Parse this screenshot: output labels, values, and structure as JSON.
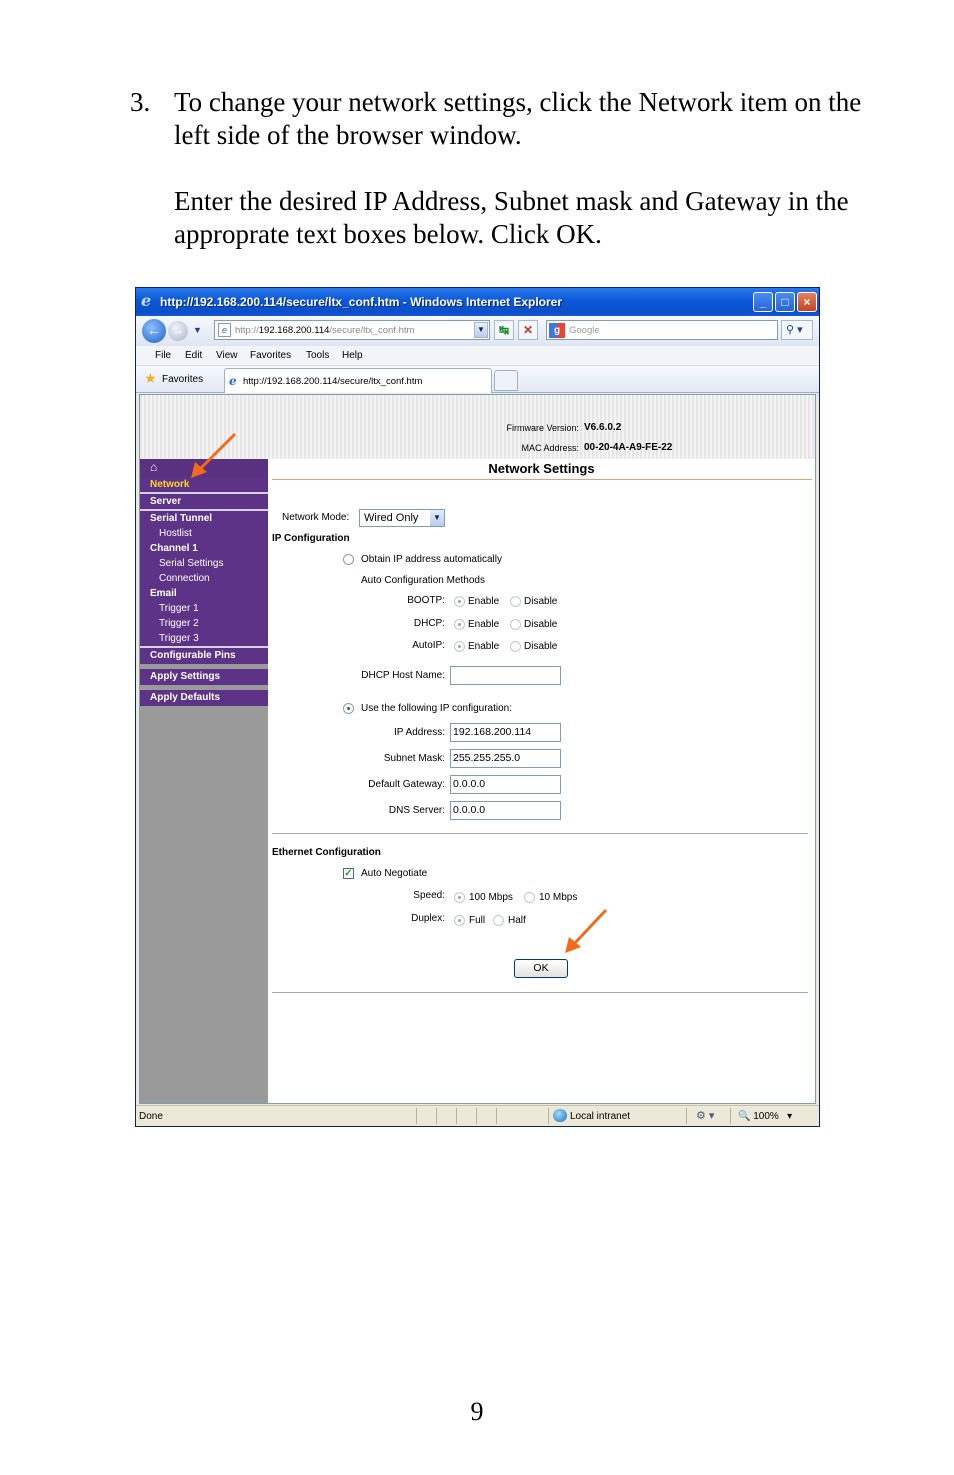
{
  "doc": {
    "step_number": "3.",
    "paragraph1": "To change your network settings, click the Network item on the left side of the browser window.",
    "paragraph2": "Enter the desired IP Address, Subnet mask and Gateway in the approprate text boxes below.  Click OK.",
    "page_number": "9"
  },
  "browser": {
    "window_title": "http://192.168.200.114/secure/ltx_conf.htm - Windows Internet Explorer",
    "address_prefix": "http://",
    "address_host": "192.168.200.114",
    "address_path": "/secure/ltx_conf.htm",
    "search_placeholder": "Google",
    "menu": [
      "File",
      "Edit",
      "View",
      "Favorites",
      "Tools",
      "Help"
    ],
    "favorites_label": "Favorites",
    "tab_title": "http://192.168.200.114/secure/ltx_conf.htm",
    "status": {
      "left": "Done",
      "zone": "Local intranet",
      "zoom": "100%"
    }
  },
  "device": {
    "firmware_label": "Firmware Version:",
    "firmware_value": "V6.6.0.2",
    "mac_label": "MAC Address:",
    "mac_value": "00-20-4A-A9-FE-22"
  },
  "sidebar": {
    "items": [
      {
        "label": "Network",
        "selected": true
      },
      {
        "label": "Server"
      },
      {
        "label": "Serial Tunnel"
      },
      {
        "label": "Hostlist"
      },
      {
        "label": "Channel 1"
      },
      {
        "label": "Serial Settings"
      },
      {
        "label": "Connection"
      },
      {
        "label": "Email"
      },
      {
        "label": "Trigger 1"
      },
      {
        "label": "Trigger 2"
      },
      {
        "label": "Trigger 3"
      },
      {
        "label": "Configurable Pins"
      },
      {
        "label": "Apply Settings"
      },
      {
        "label": "Apply Defaults"
      }
    ]
  },
  "form": {
    "title": "Network Settings",
    "network_mode_label": "Network Mode:",
    "network_mode_value": "Wired Only",
    "ip_config_heading": "IP Configuration",
    "obtain_auto_label": "Obtain IP address automatically",
    "auto_methods_label": "Auto Configuration Methods",
    "bootp_label": "BOOTP:",
    "dhcp_label": "DHCP:",
    "autoip_label": "AutoIP:",
    "enable_label": "Enable",
    "disable_label": "Disable",
    "dhcp_host_label": "DHCP Host Name:",
    "dhcp_host_value": "",
    "use_following_label": "Use the following IP configuration:",
    "ip_label": "IP Address:",
    "ip_value": "192.168.200.114",
    "subnet_label": "Subnet Mask:",
    "subnet_value": "255.255.255.0",
    "gateway_label": "Default Gateway:",
    "gateway_value": "0.0.0.0",
    "dns_label": "DNS Server:",
    "dns_value": "0.0.0.0",
    "ethernet_heading": "Ethernet Configuration",
    "auto_negotiate_label": "Auto Negotiate",
    "auto_negotiate_checked": true,
    "speed_label": "Speed:",
    "speed_100": "100 Mbps",
    "speed_10": "10 Mbps",
    "duplex_label": "Duplex:",
    "duplex_full": "Full",
    "duplex_half": "Half",
    "ok_label": "OK"
  },
  "colors": {
    "sidebar_purple": "#5c3386",
    "selected_yellow": "#ffd42a",
    "annotation_arrow": "#f26b1d"
  }
}
